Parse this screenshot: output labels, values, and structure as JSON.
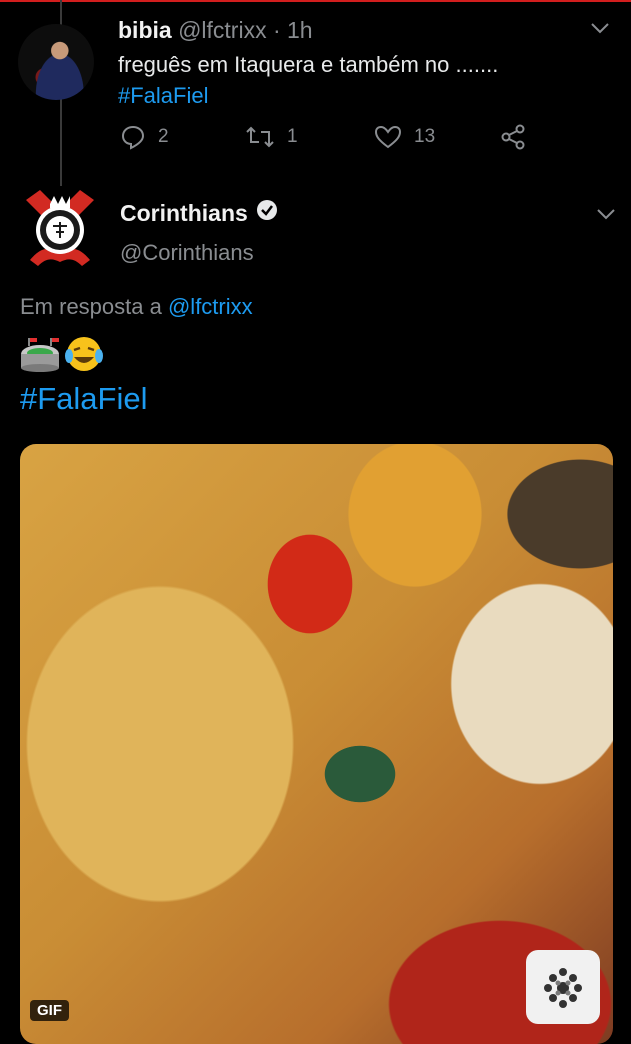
{
  "tweet1": {
    "name": "bibia",
    "handle": "@lfctrixx",
    "time": "· 1h",
    "text": "freguês em Itaquera e também no .......",
    "hashtag": "#FalaFiel",
    "replies": "2",
    "retweets": "1",
    "likes": "13"
  },
  "tweet2": {
    "name": "Corinthians",
    "handle": "@Corinthians",
    "reply_prefix": "Em resposta a",
    "reply_mention": "@lfctrixx",
    "hashtag": "#FalaFiel",
    "media_badge": "GIF"
  },
  "colors": {
    "background": "#000000",
    "link": "#1d9bf0",
    "secondary_text": "#8a8d91",
    "top_border": "#d21e1e"
  },
  "icons": [
    "reply-icon",
    "retweet-icon",
    "like-icon",
    "share-icon",
    "chevron-down-icon",
    "verified-badge-icon",
    "stadium-emoji",
    "laughing-tears-emoji",
    "gif-provider-logo"
  ]
}
